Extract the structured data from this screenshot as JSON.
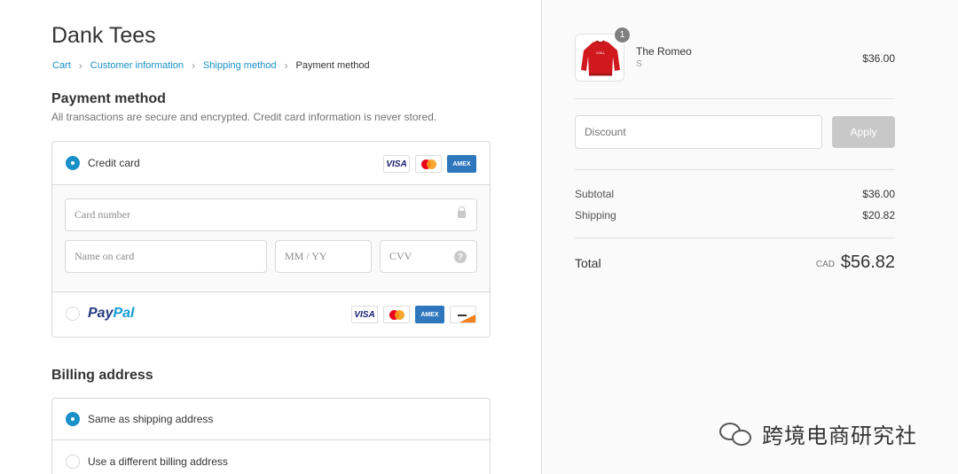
{
  "shop": {
    "name": "Dank Tees"
  },
  "breadcrumb": {
    "items": [
      "Cart",
      "Customer information",
      "Shipping method",
      "Payment method"
    ],
    "separator": "›"
  },
  "payment": {
    "title": "Payment method",
    "subtitle": "All transactions are secure and encrypted. Credit card information is never stored.",
    "credit_card": {
      "label": "Credit card",
      "selected": true,
      "card_icons": [
        "VISA",
        "mastercard",
        "AMEX"
      ],
      "fields": {
        "card_number": {
          "placeholder": "Card number"
        },
        "name_on_card": {
          "placeholder": "Name on card"
        },
        "expiry": {
          "placeholder": "MM / YY"
        },
        "cvv": {
          "placeholder": "CVV"
        }
      },
      "help_glyph": "?"
    },
    "paypal": {
      "brand_part1": "Pay",
      "brand_part2": "Pal",
      "selected": false,
      "card_icons": [
        "VISA",
        "mastercard",
        "AMEX",
        "discover"
      ]
    }
  },
  "billing": {
    "title": "Billing address",
    "options": [
      {
        "label": "Same as shipping address",
        "selected": true
      },
      {
        "label": "Use a different billing address",
        "selected": false
      }
    ]
  },
  "order": {
    "item": {
      "name": "The Romeo",
      "variant": "S",
      "price": "$36.00",
      "quantity": "1",
      "image_label": "CHILL"
    },
    "discount": {
      "placeholder": "Discount",
      "button": "Apply"
    },
    "subtotal": {
      "label": "Subtotal",
      "value": "$36.00"
    },
    "shipping": {
      "label": "Shipping",
      "value": "$20.82"
    },
    "total": {
      "label": "Total",
      "currency": "CAD",
      "value": "$56.82"
    }
  },
  "watermark": {
    "text": "跨境电商研究社"
  },
  "colors": {
    "accent": "#1990c6",
    "sidebar_bg": "#fafafa",
    "apply_disabled": "#c8c8c8",
    "paypal_dark": "#253b80",
    "paypal_light": "#179bd7"
  }
}
